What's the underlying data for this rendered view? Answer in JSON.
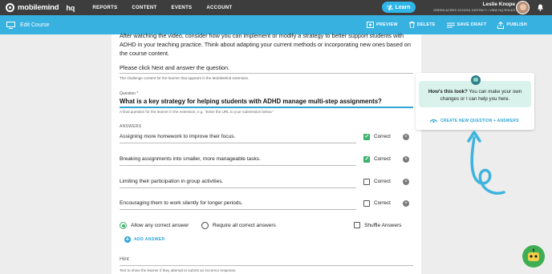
{
  "topnav": {
    "logo_text": "mobilemind",
    "logo_suffix": "hq",
    "links": [
      "REPORTS",
      "CONTENT",
      "EVENTS",
      "ACCOUNT"
    ],
    "learn_label": "Learn",
    "user_name": "Leslie Knope",
    "user_sub": "GREEN ACRES SCHOOL DISTRICT • VIEW HQ ROLES"
  },
  "editbar": {
    "title": "Edit Course",
    "actions": [
      "PREVIEW",
      "DELETE",
      "SAVE DRAFT",
      "PUBLISH"
    ]
  },
  "form": {
    "intro": "After watching the video, consider how you can implement or modify a strategy to better support students with ADHD in your teaching practice. Think about adapting your current methods or incorporating new ones based on the course content.",
    "challenge_value": "Please click Next and answer the question.",
    "challenge_helper": "The challenge content for the learner that appears in the MobileMind extension.",
    "question_label": "Question *",
    "question_value": "What is a key strategy for helping students with ADHD manage multi-step assignments?",
    "question_helper": "A final question for the learner in the extension, e.g. \"Enter the URL to your submission below.\"",
    "answers_label": "ANSWERS",
    "answers": [
      {
        "text": "Assigning more homework to improve their focus.",
        "correct": true
      },
      {
        "text": "Breaking assignments into smaller, more manageable tasks.",
        "correct": true
      },
      {
        "text": "Limiting their participation in group activities.",
        "correct": false
      },
      {
        "text": "Encouraging them to work silently for longer periods.",
        "correct": false
      }
    ],
    "correct_label": "Correct",
    "radio_any": "Allow any correct answer",
    "radio_all": "Require all correct answers",
    "radio_selected": "any",
    "shuffle_label": "Shuffle Answers",
    "shuffle_checked": false,
    "add_answer": "ADD ANSWER",
    "hint_label": "Hint",
    "hint_helper": "Text to show the learner if they attempt to submit an incorrect response."
  },
  "assistant": {
    "bold": "How's this look?",
    "message": "You can make your own changes or I can help you here.",
    "action": "CREATE NEW QUESTION + ANSWERS"
  },
  "colors": {
    "nav_bg": "#3d3d3d",
    "editbar_bg": "#37b1e0",
    "accent": "#2ea6d8",
    "green": "#3db36b"
  }
}
